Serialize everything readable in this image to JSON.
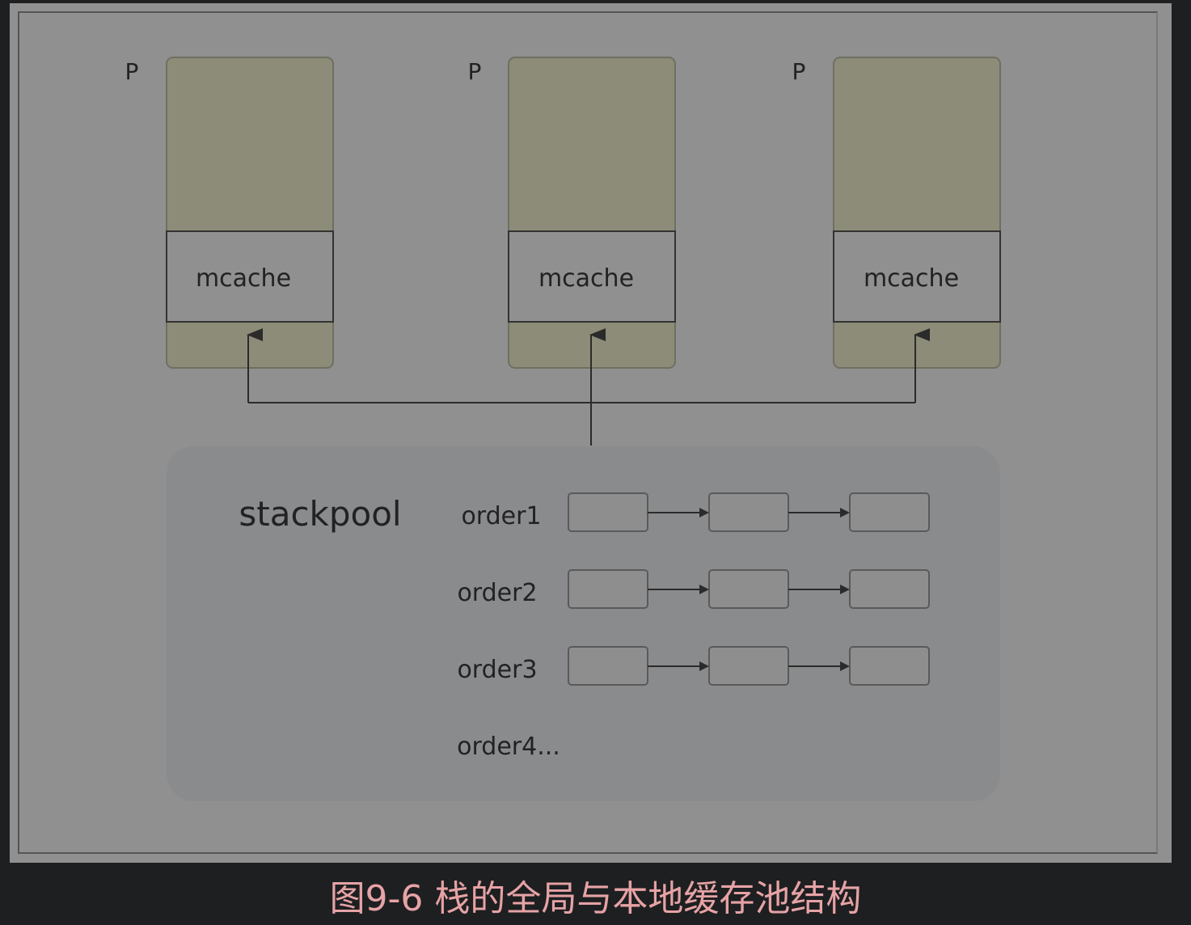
{
  "processors": [
    {
      "label": "P",
      "cache_label": "mcache"
    },
    {
      "label": "P",
      "cache_label": "mcache"
    },
    {
      "label": "P",
      "cache_label": "mcache"
    }
  ],
  "stackpool": {
    "title": "stackpool",
    "orders": [
      {
        "label": "order1",
        "nodes": 3
      },
      {
        "label": "order2",
        "nodes": 3
      },
      {
        "label": "order3",
        "nodes": 3
      },
      {
        "label": "order4...",
        "nodes": 0
      }
    ]
  },
  "caption": "图9-6 栈的全局与本地缓存池结构",
  "colors": {
    "background": "#909090",
    "processor_fill": "#8c8c78",
    "pool_fill": "#8a8b8d",
    "caption": "#e6a3a5"
  }
}
